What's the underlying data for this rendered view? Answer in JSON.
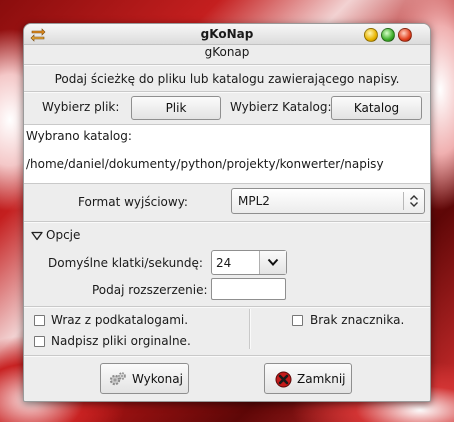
{
  "window": {
    "title": "gKoNap"
  },
  "header": {
    "app_name": "gKonap",
    "instruction": "Podaj ścieżkę do pliku lub katalogu zawierającego napisy."
  },
  "file_row": {
    "file_label": "Wybierz plik:",
    "file_button": "Plik",
    "dir_label": "Wybierz Katalog:",
    "dir_button": "Katalog"
  },
  "selection": {
    "line1": "Wybrano katalog:",
    "line2": "/home/daniel/dokumenty/python/projekty/konwerter/napisy"
  },
  "format": {
    "label": "Format wyjściowy:",
    "value": "MPL2"
  },
  "options": {
    "expander_label": "Opcje",
    "fps_label": "Domyślne klatki/sekundę:",
    "fps_value": "24",
    "ext_label": "Podaj rozszerzenie:",
    "ext_value": ""
  },
  "checkboxes": {
    "subdirs": "Wraz z podkatalogami.",
    "overwrite": "Nadpisz pliki orginalne.",
    "no_marker": "Brak znacznika."
  },
  "actions": {
    "run_label": "Wykonaj",
    "close_label": "Zamknij"
  }
}
